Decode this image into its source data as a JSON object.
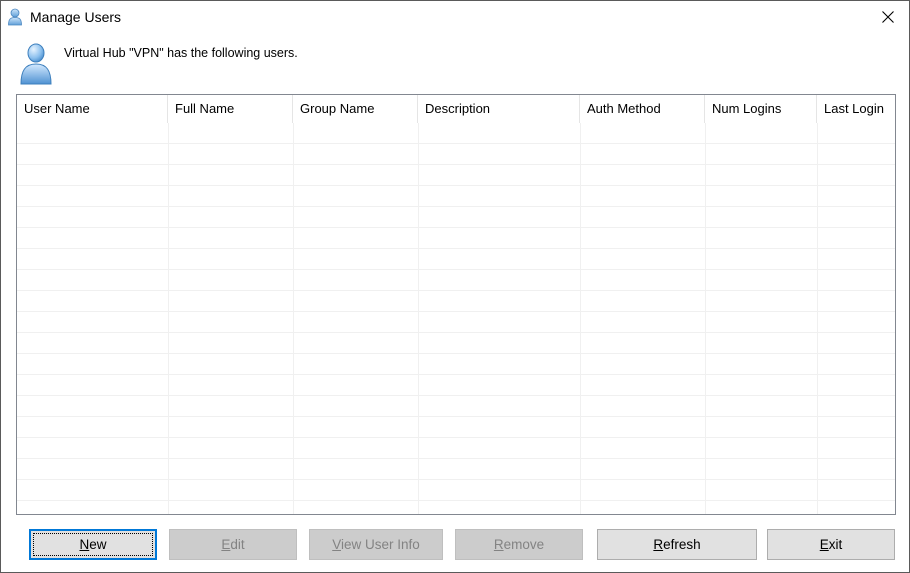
{
  "window": {
    "title": "Manage Users",
    "close_icon": "close-icon",
    "title_icon": "user-icon"
  },
  "header": {
    "message": "Virtual Hub \"VPN\" has the following users.",
    "icon": "user-avatar-icon"
  },
  "users_list": {
    "columns": [
      "User Name",
      "Full Name",
      "Group Name",
      "Description",
      "Auth Method",
      "Num Logins",
      "Last Login"
    ],
    "rows": []
  },
  "buttons": {
    "new": {
      "mnemonic": "N",
      "rest": "ew",
      "enabled": true
    },
    "edit": {
      "mnemonic": "E",
      "rest": "dit",
      "enabled": false
    },
    "view_user_info": {
      "mnemonic": "V",
      "rest": "iew User Info",
      "enabled": false
    },
    "remove": {
      "mnemonic": "R",
      "rest": "emove",
      "enabled": false
    },
    "refresh": {
      "mnemonic": "R",
      "rest": "efresh",
      "enabled": true
    },
    "exit": {
      "mnemonic": "E",
      "rest": "xit",
      "enabled": true
    }
  }
}
